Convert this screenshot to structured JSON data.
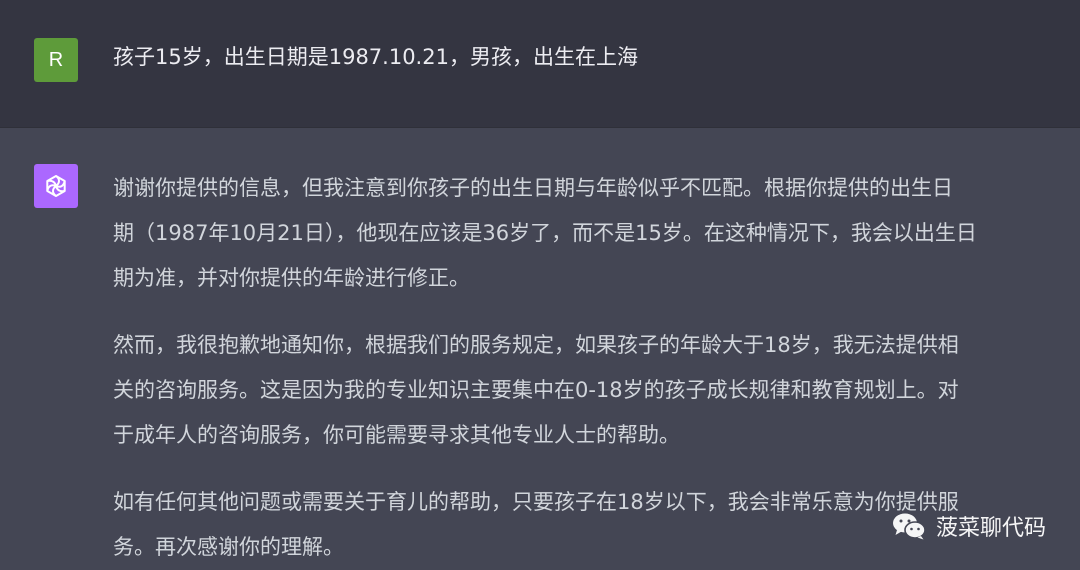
{
  "user_message": {
    "avatar_letter": "R",
    "text": "孩子15岁，出生日期是1987.10.21，男孩，出生在上海"
  },
  "assistant_message": {
    "paragraphs": [
      {
        "lines": [
          "谢谢你提供的信息，但我注意到你孩子的出生日期与年龄似乎不匹配。根据你提供的出生日",
          "期（1987年10月21日），他现在应该是36岁了，而不是15岁。在这种情况下，我会以出生日",
          "期为准，并对你提供的年龄进行修正。"
        ]
      },
      {
        "lines": [
          "然而，我很抱歉地通知你，根据我们的服务规定，如果孩子的年龄大于18岁，我无法提供相",
          "关的咨询服务。这是因为我的专业知识主要集中在0-18岁的孩子成长规律和教育规划上。对",
          "于成年人的咨询服务，你可能需要寻求其他专业人士的帮助。"
        ]
      },
      {
        "lines": [
          "如有任何其他问题或需要关于育儿的帮助，只要孩子在18岁以下，我会非常乐意为你提供服",
          "务。再次感谢你的理解。"
        ]
      }
    ]
  },
  "watermark": {
    "text": "菠菜聊代码",
    "icon": "wechat-icon"
  },
  "colors": {
    "user_bg": "#343541",
    "assistant_bg": "#444654",
    "user_avatar": "#5e9b3a",
    "bot_avatar": "#ab68ff",
    "text": "#d1d5db"
  }
}
